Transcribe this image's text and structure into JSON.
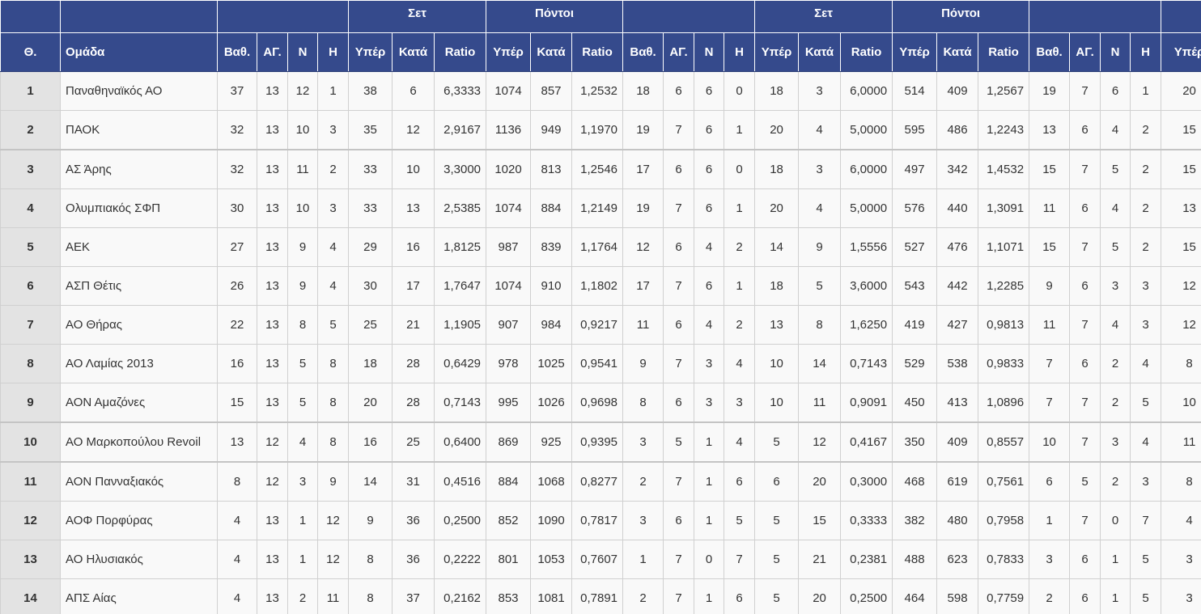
{
  "header": {
    "groups": [
      "",
      "",
      "",
      "Σετ",
      "Πόντοι",
      "",
      "Σετ",
      "Πόντοι",
      "",
      ""
    ],
    "columns": [
      "Θ.",
      "Ομάδα",
      "Βαθ.",
      "ΑΓ.",
      "Ν",
      "Η",
      "Υπέρ",
      "Κατά",
      "Ratio",
      "Υπέρ",
      "Κατά",
      "Ratio",
      "Βαθ.",
      "ΑΓ.",
      "Ν",
      "Η",
      "Υπέρ",
      "Κατά",
      "Ratio",
      "Υπέρ",
      "Κατά",
      "Ratio",
      "Βαθ.",
      "ΑΓ.",
      "Ν",
      "Η",
      "Υπέρ"
    ]
  },
  "rows": [
    [
      "1",
      "Παναθηναϊκός ΑΟ",
      "37",
      "13",
      "12",
      "1",
      "38",
      "6",
      "6,3333",
      "1074",
      "857",
      "1,2532",
      "18",
      "6",
      "6",
      "0",
      "18",
      "3",
      "6,0000",
      "514",
      "409",
      "1,2567",
      "19",
      "7",
      "6",
      "1",
      "20"
    ],
    [
      "2",
      "ΠΑΟΚ",
      "32",
      "13",
      "10",
      "3",
      "35",
      "12",
      "2,9167",
      "1136",
      "949",
      "1,1970",
      "19",
      "7",
      "6",
      "1",
      "20",
      "4",
      "5,0000",
      "595",
      "486",
      "1,2243",
      "13",
      "6",
      "4",
      "2",
      "15"
    ],
    [
      "3",
      "ΑΣ Άρης",
      "32",
      "13",
      "11",
      "2",
      "33",
      "10",
      "3,3000",
      "1020",
      "813",
      "1,2546",
      "17",
      "6",
      "6",
      "0",
      "18",
      "3",
      "6,0000",
      "497",
      "342",
      "1,4532",
      "15",
      "7",
      "5",
      "2",
      "15"
    ],
    [
      "4",
      "Ολυμπιακός ΣΦΠ",
      "30",
      "13",
      "10",
      "3",
      "33",
      "13",
      "2,5385",
      "1074",
      "884",
      "1,2149",
      "19",
      "7",
      "6",
      "1",
      "20",
      "4",
      "5,0000",
      "576",
      "440",
      "1,3091",
      "11",
      "6",
      "4",
      "2",
      "13"
    ],
    [
      "5",
      "ΑΕΚ",
      "27",
      "13",
      "9",
      "4",
      "29",
      "16",
      "1,8125",
      "987",
      "839",
      "1,1764",
      "12",
      "6",
      "4",
      "2",
      "14",
      "9",
      "1,5556",
      "527",
      "476",
      "1,1071",
      "15",
      "7",
      "5",
      "2",
      "15"
    ],
    [
      "6",
      "ΑΣΠ Θέτις",
      "26",
      "13",
      "9",
      "4",
      "30",
      "17",
      "1,7647",
      "1074",
      "910",
      "1,1802",
      "17",
      "7",
      "6",
      "1",
      "18",
      "5",
      "3,6000",
      "543",
      "442",
      "1,2285",
      "9",
      "6",
      "3",
      "3",
      "12"
    ],
    [
      "7",
      "ΑΟ Θήρας",
      "22",
      "13",
      "8",
      "5",
      "25",
      "21",
      "1,1905",
      "907",
      "984",
      "0,9217",
      "11",
      "6",
      "4",
      "2",
      "13",
      "8",
      "1,6250",
      "419",
      "427",
      "0,9813",
      "11",
      "7",
      "4",
      "3",
      "12"
    ],
    [
      "8",
      "ΑΟ Λαμίας 2013",
      "16",
      "13",
      "5",
      "8",
      "18",
      "28",
      "0,6429",
      "978",
      "1025",
      "0,9541",
      "9",
      "7",
      "3",
      "4",
      "10",
      "14",
      "0,7143",
      "529",
      "538",
      "0,9833",
      "7",
      "6",
      "2",
      "4",
      "8"
    ],
    [
      "9",
      "ΑΟΝ Αμαζόνες",
      "15",
      "13",
      "5",
      "8",
      "20",
      "28",
      "0,7143",
      "995",
      "1026",
      "0,9698",
      "8",
      "6",
      "3",
      "3",
      "10",
      "11",
      "0,9091",
      "450",
      "413",
      "1,0896",
      "7",
      "7",
      "2",
      "5",
      "10"
    ],
    [
      "10",
      "ΑΟ Μαρκοπούλου Revoil",
      "13",
      "12",
      "4",
      "8",
      "16",
      "25",
      "0,6400",
      "869",
      "925",
      "0,9395",
      "3",
      "5",
      "1",
      "4",
      "5",
      "12",
      "0,4167",
      "350",
      "409",
      "0,8557",
      "10",
      "7",
      "3",
      "4",
      "11"
    ],
    [
      "11",
      "ΑΟΝ Πανναξιακός",
      "8",
      "12",
      "3",
      "9",
      "14",
      "31",
      "0,4516",
      "884",
      "1068",
      "0,8277",
      "2",
      "7",
      "1",
      "6",
      "6",
      "20",
      "0,3000",
      "468",
      "619",
      "0,7561",
      "6",
      "5",
      "2",
      "3",
      "8"
    ],
    [
      "12",
      "ΑΟΦ Πορφύρας",
      "4",
      "13",
      "1",
      "12",
      "9",
      "36",
      "0,2500",
      "852",
      "1090",
      "0,7817",
      "3",
      "6",
      "1",
      "5",
      "5",
      "15",
      "0,3333",
      "382",
      "480",
      "0,7958",
      "1",
      "7",
      "0",
      "7",
      "4"
    ],
    [
      "13",
      "ΑΟ Ηλυσιακός",
      "4",
      "13",
      "1",
      "12",
      "8",
      "36",
      "0,2222",
      "801",
      "1053",
      "0,7607",
      "1",
      "7",
      "0",
      "7",
      "5",
      "21",
      "0,2381",
      "488",
      "623",
      "0,7833",
      "3",
      "6",
      "1",
      "5",
      "3"
    ],
    [
      "14",
      "ΑΠΣ Αίας",
      "4",
      "13",
      "2",
      "11",
      "8",
      "37",
      "0,2162",
      "853",
      "1081",
      "0,7891",
      "2",
      "7",
      "1",
      "6",
      "5",
      "20",
      "0,2500",
      "464",
      "598",
      "0,7759",
      "2",
      "6",
      "1",
      "5",
      "3"
    ]
  ],
  "colors": {
    "header_bg": "#354a8c",
    "header_text": "#ffffff",
    "row_bg": "#f9f9f9",
    "pos_bg": "#e3e3e3"
  }
}
